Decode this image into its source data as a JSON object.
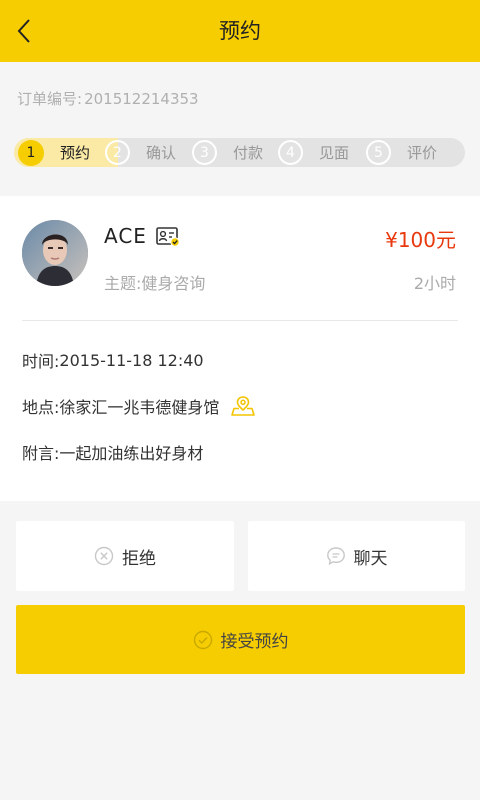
{
  "header": {
    "title": "预约",
    "back_icon": "chevron-left-icon"
  },
  "order": {
    "label": "订单编号:",
    "number": "201512214353"
  },
  "steps": [
    {
      "num": "1",
      "label": "预约",
      "active": true
    },
    {
      "num": "2",
      "label": "确认",
      "active": false
    },
    {
      "num": "3",
      "label": "付款",
      "active": false
    },
    {
      "num": "4",
      "label": "见面",
      "active": false
    },
    {
      "num": "5",
      "label": "评价",
      "active": false
    }
  ],
  "profile": {
    "name": "ACE",
    "price": "¥100元",
    "topic": "主题:健身咨询",
    "duration": "2小时",
    "id_icon": "id-card-verified-icon"
  },
  "details": {
    "time_label": "时间:",
    "time_value": "2015-11-18 12:40",
    "place_label": "地点:",
    "place_value": "徐家汇一兆韦德健身馆",
    "note_label": "附言:",
    "note_value": "一起加油练出好身材"
  },
  "actions": {
    "reject_label": "拒绝",
    "chat_label": "聊天",
    "accept_label": "接受预约"
  },
  "colors": {
    "accent": "#f5cd00",
    "price": "#e8380d",
    "background": "#f5f5f5"
  }
}
